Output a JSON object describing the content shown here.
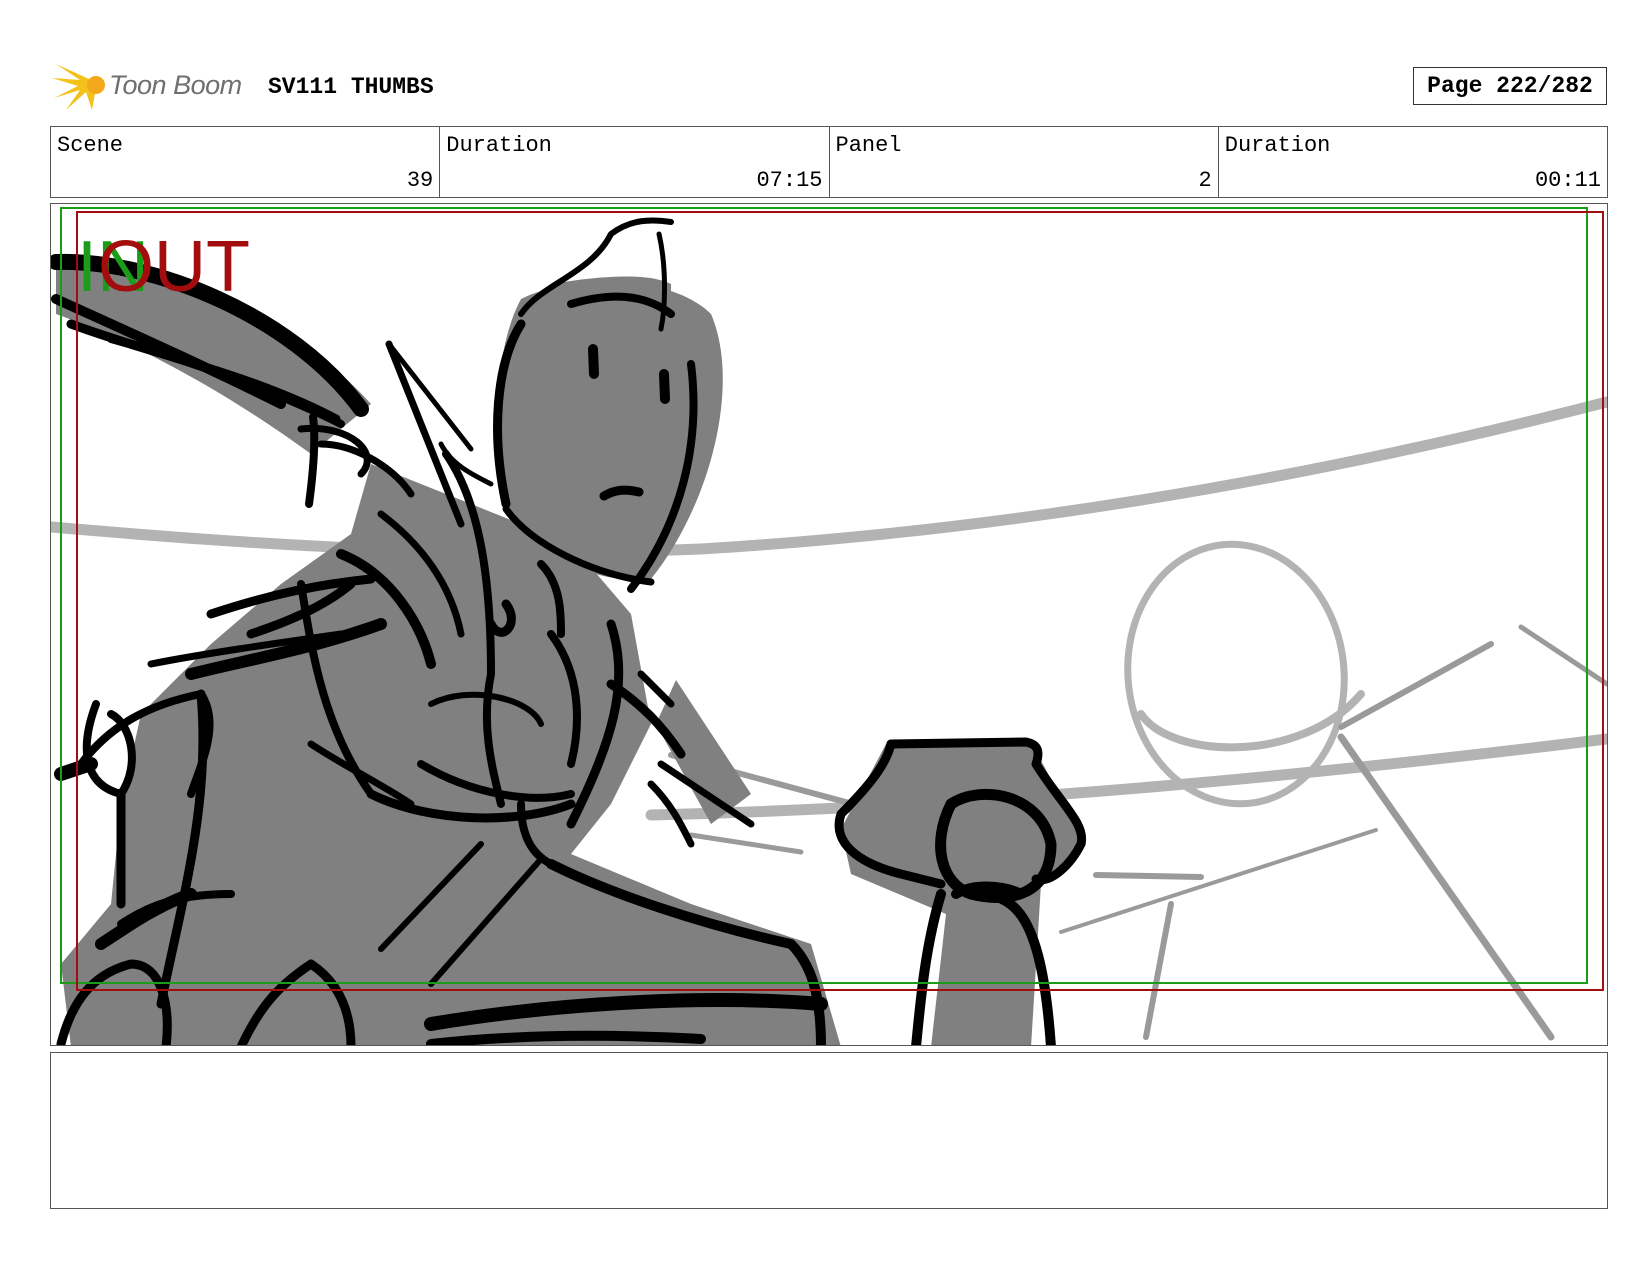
{
  "header": {
    "logo_text": "Toon Boom",
    "board_title": "SV111 THUMBS",
    "page_label": "Page 222/282"
  },
  "info": {
    "scene": {
      "label": "Scene",
      "value": "39"
    },
    "scene_duration": {
      "label": "Duration",
      "value": "07:15"
    },
    "panel": {
      "label": "Panel",
      "value": "2"
    },
    "panel_duration": {
      "label": "Duration",
      "value": "00:11"
    }
  },
  "panel": {
    "in_marker": "IN",
    "out_marker": "OUT",
    "in_color": "#1a9e1a",
    "out_color": "#a30d0d",
    "fill_color": "#808080",
    "line_color": "#000000",
    "background_sketch_color": "#b3b3b3"
  },
  "notes": {
    "text": ""
  }
}
